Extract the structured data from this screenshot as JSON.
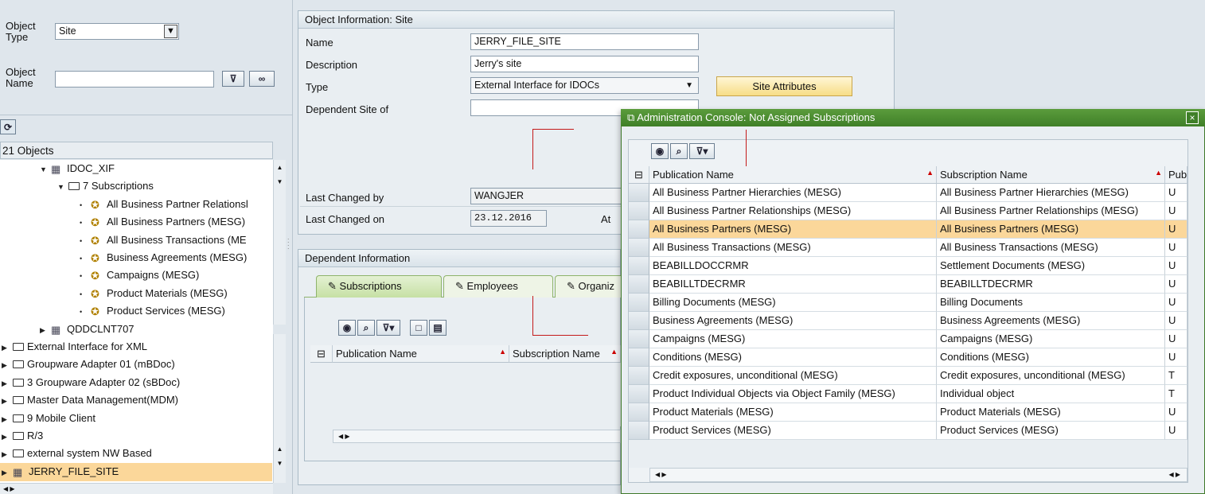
{
  "left_panel": {
    "object_type_label": "Object\nType",
    "object_type_value": "Site",
    "object_name_label": "Object\nName",
    "object_name_value": "",
    "count_label": "21 Objects",
    "tree": [
      {
        "label": "IDOC_XIF",
        "level": 1,
        "expand": "▼",
        "icon": "site-icon"
      },
      {
        "label": "7 Subscriptions",
        "level": 2,
        "expand": "▼",
        "icon": "folder-open-icon"
      },
      {
        "label": "All Business Partner Relationsl",
        "level": 3,
        "expand": "•",
        "icon": "subscription-icon"
      },
      {
        "label": "All Business Partners (MESG)",
        "level": 3,
        "expand": "•",
        "icon": "subscription-icon"
      },
      {
        "label": "All Business Transactions (ME",
        "level": 3,
        "expand": "•",
        "icon": "subscription-icon"
      },
      {
        "label": "Business Agreements (MESG)",
        "level": 3,
        "expand": "•",
        "icon": "subscription-icon"
      },
      {
        "label": "Campaigns (MESG)",
        "level": 3,
        "expand": "•",
        "icon": "subscription-icon"
      },
      {
        "label": "Product Materials (MESG)",
        "level": 3,
        "expand": "•",
        "icon": "subscription-icon"
      },
      {
        "label": "Product Services (MESG)",
        "level": 3,
        "expand": "•",
        "icon": "subscription-icon"
      },
      {
        "label": "QDDCLNT707",
        "level": 1,
        "expand": "▶",
        "icon": "site-icon"
      },
      {
        "label": "External Interface for XML",
        "level": 0,
        "expand": "▶",
        "icon": "folder-icon"
      },
      {
        "label": "Groupware Adapter 01 (mBDoc)",
        "level": 0,
        "expand": "▶",
        "icon": "folder-icon"
      },
      {
        "label": "3 Groupware Adapter 02 (sBDoc)",
        "level": 0,
        "expand": "▶",
        "icon": "folder-icon"
      },
      {
        "label": "Master Data Management(MDM)",
        "level": 0,
        "expand": "▶",
        "icon": "folder-icon"
      },
      {
        "label": "9 Mobile Client",
        "level": 0,
        "expand": "▶",
        "icon": "folder-icon"
      },
      {
        "label": "R/3",
        "level": 0,
        "expand": "▶",
        "icon": "folder-icon"
      },
      {
        "label": "external system NW Based",
        "level": 0,
        "expand": "▶",
        "icon": "folder-icon"
      },
      {
        "label": "JERRY_FILE_SITE",
        "level": 0,
        "expand": "▶",
        "icon": "site-icon",
        "selected": true
      }
    ]
  },
  "object_info": {
    "title": "Object Information: Site",
    "name_label": "Name",
    "name_value": "JERRY_FILE_SITE",
    "description_label": "Description",
    "description_value": "Jerry's site",
    "type_label": "Type",
    "type_value": "External Interface for IDOCs",
    "site_attributes_button": "Site Attributes",
    "dependent_site_label": "Dependent Site of",
    "dependent_site_value": "",
    "last_changed_by_label": "Last Changed by",
    "last_changed_by_value": "WANGJER",
    "last_changed_on_label": "Last Changed on",
    "last_changed_on_value": "23.12.2016",
    "at_label": "At"
  },
  "dependent_info": {
    "title": "Dependent Information",
    "tabs": [
      "Subscriptions",
      "Employees",
      "Organiz"
    ],
    "col_publication": "Publication Name",
    "col_subscription": "Subscription Name"
  },
  "popup": {
    "title": "Administration Console: Not Assigned Subscriptions",
    "col_publication": "Publication Name",
    "col_subscription": "Subscription Name",
    "col_pub": "Pub",
    "rows": [
      {
        "pub": "All Business Partner Hierarchies (MESG)",
        "sub": "All Business Partner Hierarchies (MESG)",
        "t": "U"
      },
      {
        "pub": "All Business Partner Relationships (MESG)",
        "sub": "All Business Partner Relationships (MESG)",
        "t": "U"
      },
      {
        "pub": "All Business Partners (MESG)",
        "sub": "All Business Partners (MESG)",
        "t": "U",
        "selected": true
      },
      {
        "pub": "All Business Transactions (MESG)",
        "sub": "All Business Transactions (MESG)",
        "t": "U"
      },
      {
        "pub": "BEABILLDOCCRMR",
        "sub": "Settlement Documents (MESG)",
        "t": "U"
      },
      {
        "pub": "BEABILLTDECRMR",
        "sub": "BEABILLTDECRMR",
        "t": "U"
      },
      {
        "pub": "Billing Documents (MESG)",
        "sub": "Billing Documents",
        "t": "U"
      },
      {
        "pub": "Business Agreements (MESG)",
        "sub": "Business Agreements (MESG)",
        "t": "U"
      },
      {
        "pub": "Campaigns (MESG)",
        "sub": "Campaigns (MESG)",
        "t": "U"
      },
      {
        "pub": "Conditions (MESG)",
        "sub": "Conditions (MESG)",
        "t": "U"
      },
      {
        "pub": "Credit exposures, unconditional (MESG)",
        "sub": "Credit exposures, unconditional (MESG)",
        "t": "T"
      },
      {
        "pub": "Product Individual Objects via Object Family (MESG)",
        "sub": "Individual object",
        "t": "T"
      },
      {
        "pub": "Product Materials (MESG)",
        "sub": "Product Materials (MESG)",
        "t": "U"
      },
      {
        "pub": "Product Services (MESG)",
        "sub": "Product Services (MESG)",
        "t": "U"
      }
    ]
  },
  "colors": {
    "selection": "#fbd79a",
    "accent": "#7fb24f",
    "popup_title": "#4a8a2f"
  }
}
